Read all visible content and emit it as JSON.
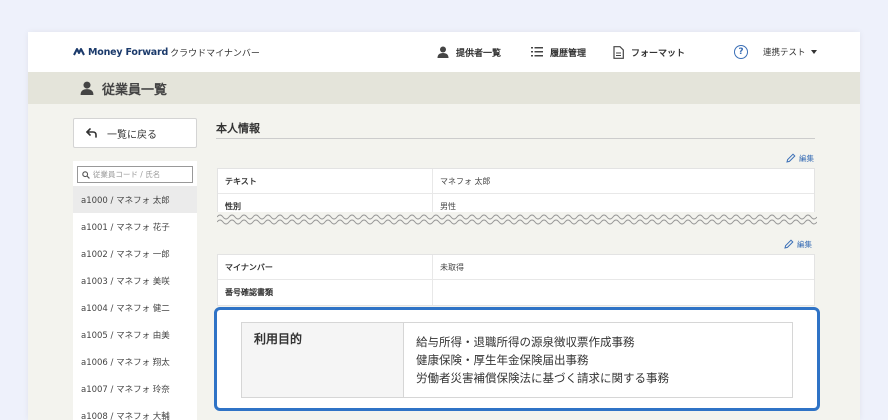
{
  "header": {
    "logo_brand": "Money Forward",
    "logo_product": "クラウドマイナンバー",
    "nav": [
      {
        "label": "提供者一覧",
        "icon": "person-icon"
      },
      {
        "label": "履歴管理",
        "icon": "list-icon"
      },
      {
        "label": "フォーマット",
        "icon": "document-icon"
      }
    ],
    "help_icon": "?",
    "user_label": "連携テスト"
  },
  "page": {
    "title": "従業員一覧"
  },
  "sidebar": {
    "back_label": "一覧に戻る",
    "search_placeholder": "従業員コード / 氏名",
    "employees": [
      "a1000 / マネフォ 太郎",
      "a1001 / マネフォ 花子",
      "a1002 / マネフォ 一郎",
      "a1003 / マネフォ 美咲",
      "a1004 / マネフォ 健二",
      "a1005 / マネフォ 由美",
      "a1006 / マネフォ 翔太",
      "a1007 / マネフォ 玲奈",
      "a1008 / マネフォ 大輔"
    ],
    "selected_index": 0
  },
  "main": {
    "section_title": "本人情報",
    "edit_label": "編集",
    "table1": [
      {
        "label": "テキスト",
        "value": "マネフォ 太郎"
      },
      {
        "label": "性別",
        "value": "男性"
      }
    ],
    "table2": [
      {
        "label": "マイナンバー",
        "value": "未取得"
      },
      {
        "label": "番号確認書類",
        "value": ""
      }
    ],
    "purpose": {
      "label": "利用目的",
      "lines": [
        "給与所得・退職所得の源泉徴収票作成事務",
        "健康保険・厚生年金保険届出事務",
        "労働者災害補償保険法に基づく請求に関する事務"
      ]
    }
  },
  "colors": {
    "accent": "#2f73c6",
    "link": "#3b6fb6",
    "brand": "#1b3a6b"
  }
}
